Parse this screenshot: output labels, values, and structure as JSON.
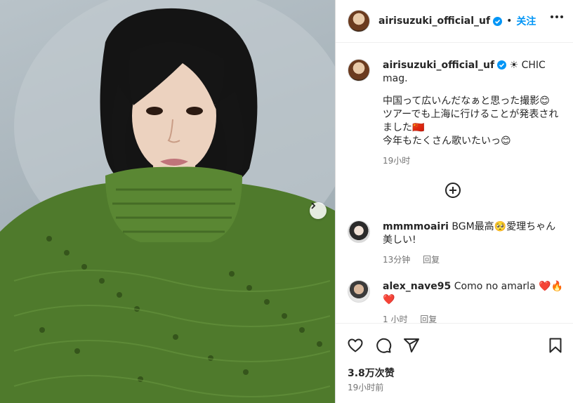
{
  "post": {
    "username": "airisuzuki_official_uf",
    "separator": "•",
    "follow_label": "关注",
    "caption_title": "☀ CHIC mag.",
    "caption_body": "中国って広いんだなぁと思った撮影😊\nツアーでも上海に行けることが発表されました🇨🇳\n今年もたくさん歌いたいっ😊",
    "caption_time": "19小时",
    "likes": "3.8万次赞",
    "posted_time": "19小时前"
  },
  "comments": [
    {
      "username": "mmmmoairi",
      "text": "BGM最高🥺愛理ちゃん美しい!",
      "time": "13分钟",
      "reply_label": "回复"
    },
    {
      "username": "alex_nave95",
      "text": "Como no amarla ❤️🔥❤️",
      "time": "1 小时",
      "reply_label": "回复"
    }
  ],
  "colors": {
    "accent": "#0095f6",
    "sweater": "#4f7a2c",
    "verified": "#0095f6"
  },
  "icons": [
    "verified-icon",
    "more-options-icon",
    "add-comment-icon",
    "heart-icon",
    "comment-icon",
    "share-icon",
    "bookmark-icon",
    "next-arrow-icon"
  ]
}
